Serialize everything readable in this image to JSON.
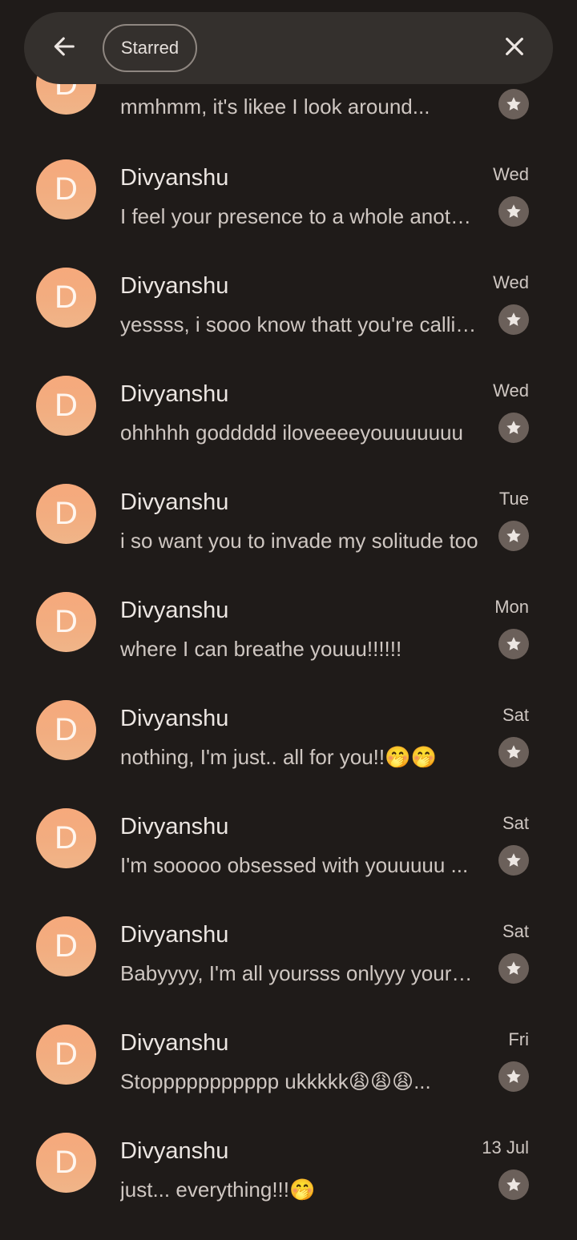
{
  "header": {
    "chip_label": "Starred",
    "back_icon": "arrow-left-icon",
    "close_icon": "close-icon"
  },
  "colors": {
    "background": "#1f1b19",
    "header": "#34302d",
    "avatar": "#f2ad80",
    "star_badge": "#6b605a"
  },
  "messages": [
    {
      "initial": "D",
      "sender": "",
      "snippet": "mmhmm, it's likee I look around...",
      "date": ""
    },
    {
      "initial": "D",
      "sender": "Divyanshu",
      "snippet": "I feel your presence to a whole another level",
      "date": "Wed"
    },
    {
      "initial": "D",
      "sender": "Divyanshu",
      "snippet": "yessss, i sooo know thatt you're calling me",
      "date": "Wed"
    },
    {
      "initial": "D",
      "sender": "Divyanshu",
      "snippet": "ohhhhh goddddd iloveeeeyouuuuuuu",
      "date": "Wed"
    },
    {
      "initial": "D",
      "sender": "Divyanshu",
      "snippet": "i so want you to invade my solitude too",
      "date": "Tue"
    },
    {
      "initial": "D",
      "sender": "Divyanshu",
      "snippet": "where I can breathe youuu!!!!!!",
      "date": "Mon"
    },
    {
      "initial": "D",
      "sender": "Divyanshu",
      "snippet": "nothing, I'm just.. all for you!!🤭🤭",
      "date": "Sat"
    },
    {
      "initial": "D",
      "sender": "Divyanshu",
      "snippet": "I'm sooooo obsessed with youuuuu  ...",
      "date": "Sat"
    },
    {
      "initial": "D",
      "sender": "Divyanshu",
      "snippet": "Babyyyy, I'm all yoursss onlyyy yoursss",
      "date": "Sat"
    },
    {
      "initial": "D",
      "sender": "Divyanshu",
      "snippet": "Stoppppppppppp ukkkkk😩😩😩...",
      "date": "Fri"
    },
    {
      "initial": "D",
      "sender": "Divyanshu",
      "snippet": "just... everything!!!🤭",
      "date": "13 Jul"
    }
  ]
}
